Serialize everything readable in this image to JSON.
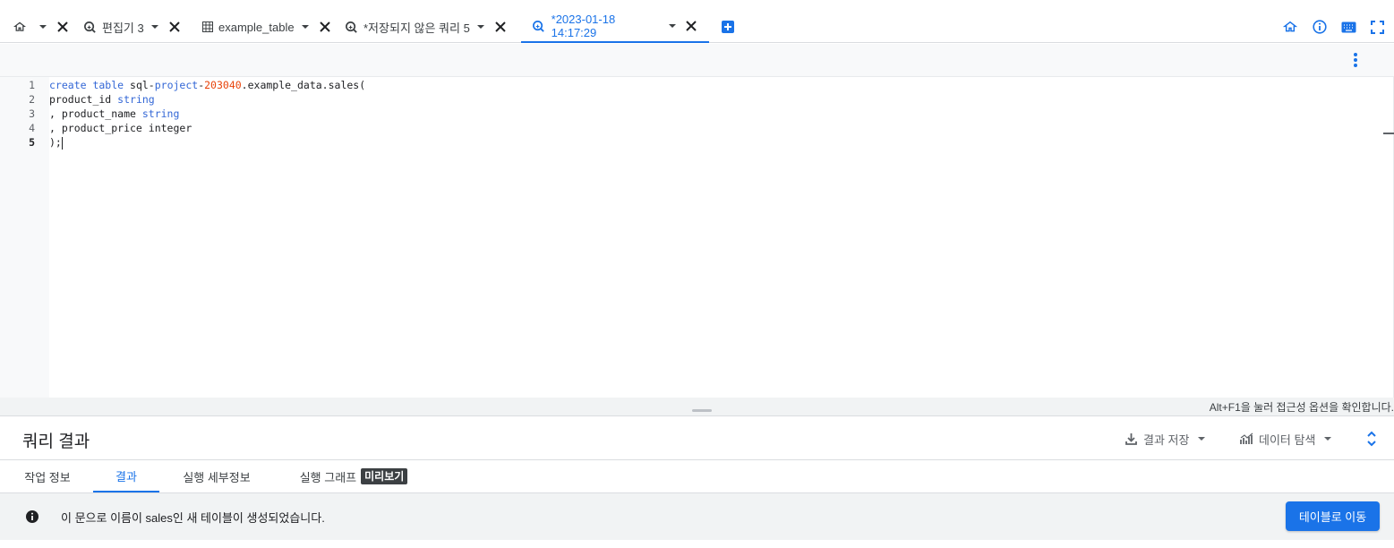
{
  "colors": {
    "accent": "#1a73e8",
    "keyword": "#3367d6",
    "number": "#e8430a",
    "badge_bg": "#3c4043"
  },
  "tabs": [
    {
      "label": "",
      "icon": "home-icon"
    },
    {
      "label": "편집기 3",
      "icon": "query-icon"
    },
    {
      "label": "example_table",
      "icon": "table-icon"
    },
    {
      "label": "*저장되지 않은 쿼리 5",
      "icon": "query-icon"
    },
    {
      "label": "*2023-01-18 14:17:29",
      "icon": "query-icon",
      "active": true
    }
  ],
  "top_icons": [
    "home-icon",
    "info-icon",
    "keyboard-icon",
    "fullscreen-icon"
  ],
  "editor": {
    "line_numbers": [
      "1",
      "2",
      "3",
      "4",
      "5"
    ],
    "lines": [
      {
        "t1": "create table",
        "t2": " sql-",
        "t3": "project",
        "t4": "-",
        "t5": "203040",
        "t6": ".example_data.sales("
      },
      {
        "t1": "product_id ",
        "t2": "string"
      },
      {
        "t1": ", product_name ",
        "t2": "string"
      },
      {
        "t1": ", product_price integer"
      },
      {
        "t1": ");"
      }
    ],
    "a11y_hint": "Alt+F1을 눌러 접근성 옵션을 확인합니다."
  },
  "results": {
    "title": "쿼리 결과",
    "save_results": "결과 저장",
    "explore_data": "데이터 탐색",
    "tabs": [
      "작업 정보",
      "결과",
      "실행 세부정보",
      "실행 그래프"
    ],
    "preview_badge": "미리보기",
    "message": "이 문으로 이름이 sales인 새 테이블이 생성되었습니다.",
    "goto_table": "테이블로 이동"
  }
}
